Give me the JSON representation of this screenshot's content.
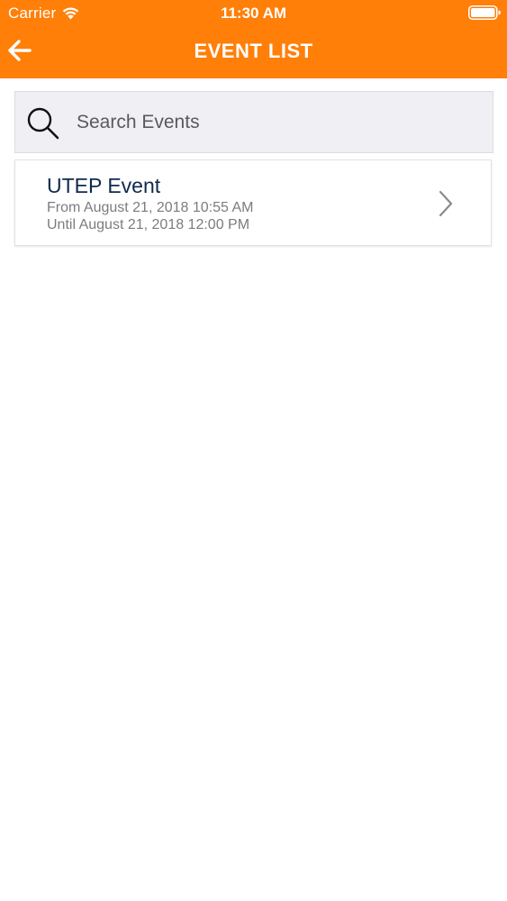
{
  "status_bar": {
    "carrier": "Carrier",
    "time": "11:30 AM",
    "wifi_icon": "wifi-icon",
    "battery_icon": "battery-full-icon"
  },
  "header": {
    "title": "EVENT LIST",
    "back_icon": "arrow-left-icon",
    "background_color": "#FF7F08"
  },
  "search": {
    "placeholder": "Search Events",
    "value": "",
    "icon": "search-icon"
  },
  "events": [
    {
      "title": "UTEP Event",
      "from": "From August 21, 2018 10:55 AM",
      "until": "Until August 21, 2018 12:00 PM",
      "icon": "chevron-right-icon"
    }
  ]
}
